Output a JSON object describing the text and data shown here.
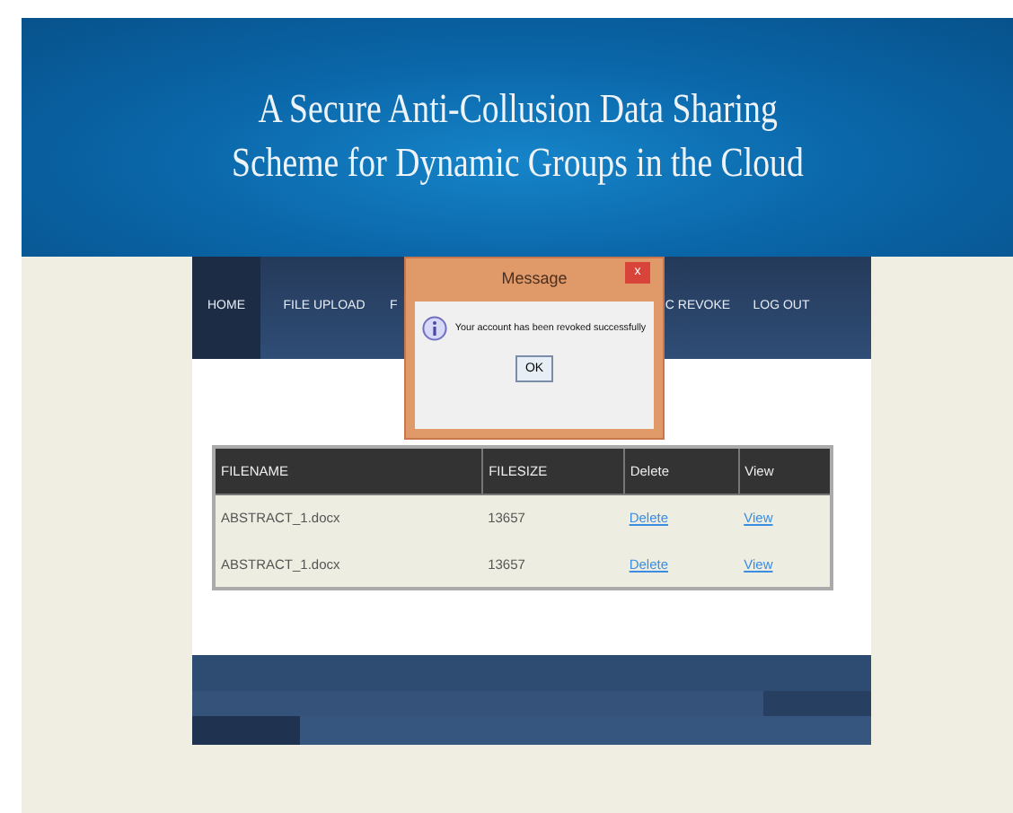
{
  "banner": {
    "title_lines": [
      "A Secure Anti-Collusion Data Sharing",
      "Scheme for Dynamic Groups in the Cloud"
    ]
  },
  "nav": [
    {
      "label": "HOME",
      "selected": true
    },
    {
      "label": "FILE UPLOAD",
      "selected": false
    },
    {
      "label": "F",
      "selected": false
    },
    {
      "label": "C REVOKE",
      "selected": false
    },
    {
      "label": "LOG OUT",
      "selected": false
    }
  ],
  "dialog": {
    "title": "Message",
    "close": "x",
    "message": "Your account has been revoked successfully",
    "button": "OK"
  },
  "table": {
    "columns": [
      "FILENAME",
      "FILESIZE",
      "Delete",
      "View"
    ],
    "rows": [
      {
        "filename": "ABSTRACT_1.docx",
        "filesize": "13657",
        "delete": "Delete",
        "view": "View"
      },
      {
        "filename": "ABSTRACT_1.docx",
        "filesize": "13657",
        "delete": "Delete",
        "view": "View"
      }
    ]
  }
}
